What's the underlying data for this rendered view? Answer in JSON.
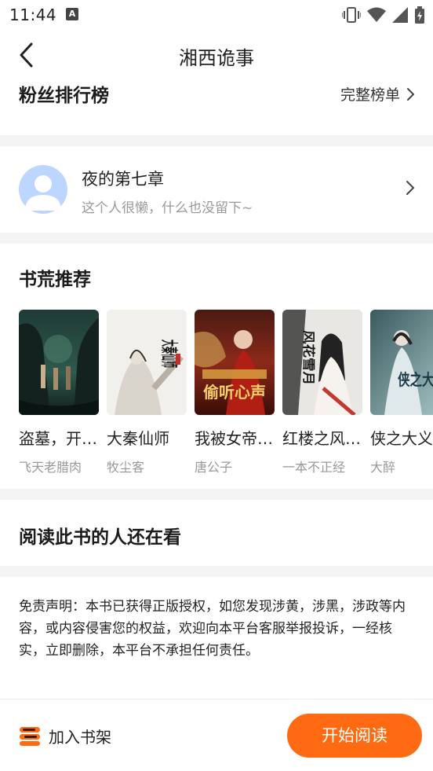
{
  "status_bar": {
    "time": "11:44",
    "notification_icon": "A"
  },
  "header": {
    "title": "湘西诡事"
  },
  "fans": {
    "title": "粉丝排行榜",
    "full_list_label": "完整榜单",
    "top_fan": {
      "name": "夜的第七章",
      "bio": "这个人很懒，什么也没留下~"
    }
  },
  "recommend": {
    "title": "书荒推荐",
    "books": [
      {
        "title": "盗墓，开…",
        "author": "飞天老腊肉",
        "cover_text": ""
      },
      {
        "title": "大秦仙师",
        "author": "牧尘客",
        "cover_text": "大秦仙师"
      },
      {
        "title": "我被女帝…",
        "author": "唐公子",
        "cover_text": "偷听心声"
      },
      {
        "title": "红楼之风…",
        "author": "一本不正经",
        "cover_text": "风花雪月"
      },
      {
        "title": "侠之大义",
        "author": "大醉",
        "cover_text": "侠之大义"
      }
    ]
  },
  "also_reading": {
    "title": "阅读此书的人还在看"
  },
  "disclaimer": {
    "text": "免责声明：本书已获得正版授权，如您发现涉黄，涉黑，涉政等内容，或内容侵害您的权益，欢迎向本平台客服举报投诉，一经核实，立即删除，本平台不承担任何责任。"
  },
  "bottom_bar": {
    "add_shelf_label": "加入书架",
    "start_read_label": "开始阅读"
  },
  "colors": {
    "accent": "#ff6a13",
    "divider": "#f4f4f4",
    "muted_text": "#999999"
  }
}
